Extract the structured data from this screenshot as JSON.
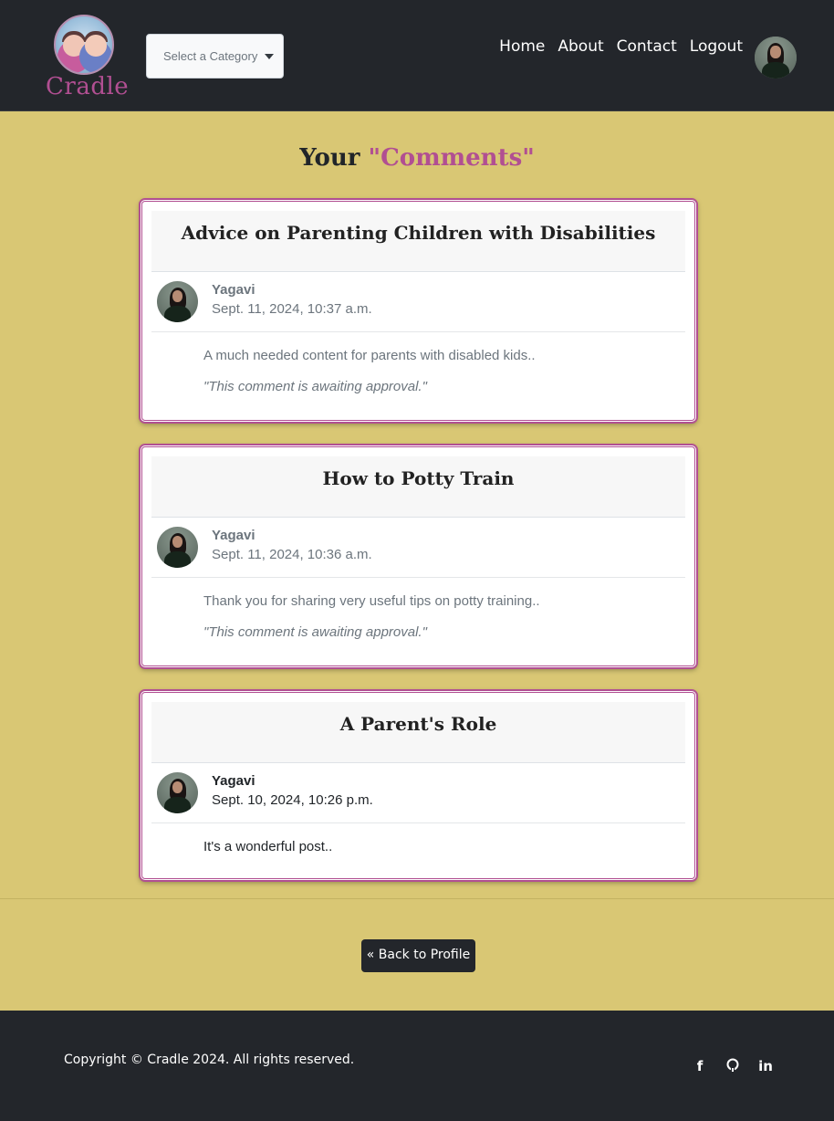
{
  "brand": {
    "name": "Cradle",
    "accent_color": "#b14f92"
  },
  "nav": {
    "category_placeholder": "Select a Category",
    "links": [
      "Home",
      "About",
      "Contact",
      "Logout"
    ]
  },
  "page": {
    "title_prefix": "Your",
    "title_accent": "\"Comments\""
  },
  "comments": [
    {
      "post_title": "Advice on Parenting Children with Disabilities",
      "author": "Yagavi",
      "date": "Sept. 11, 2024, 10:37 a.m.",
      "text": "A much needed content for parents with disabled kids..",
      "status": "\"This comment is awaiting approval.\""
    },
    {
      "post_title": "How to Potty Train",
      "author": "Yagavi",
      "date": "Sept. 11, 2024, 10:36 a.m.",
      "text": "Thank you for sharing very useful tips on potty training..",
      "status": "\"This comment is awaiting approval.\""
    },
    {
      "post_title": "A Parent's Role",
      "author": "Yagavi",
      "date": "Sept. 10, 2024, 10:26 p.m.",
      "text": "It's a wonderful post.."
    }
  ],
  "back_button": "« Back to Profile",
  "footer": {
    "copyright": "Copyright © Cradle 2024. All rights reserved.",
    "socials": [
      "facebook-icon",
      "github-icon",
      "linkedin-icon"
    ]
  }
}
